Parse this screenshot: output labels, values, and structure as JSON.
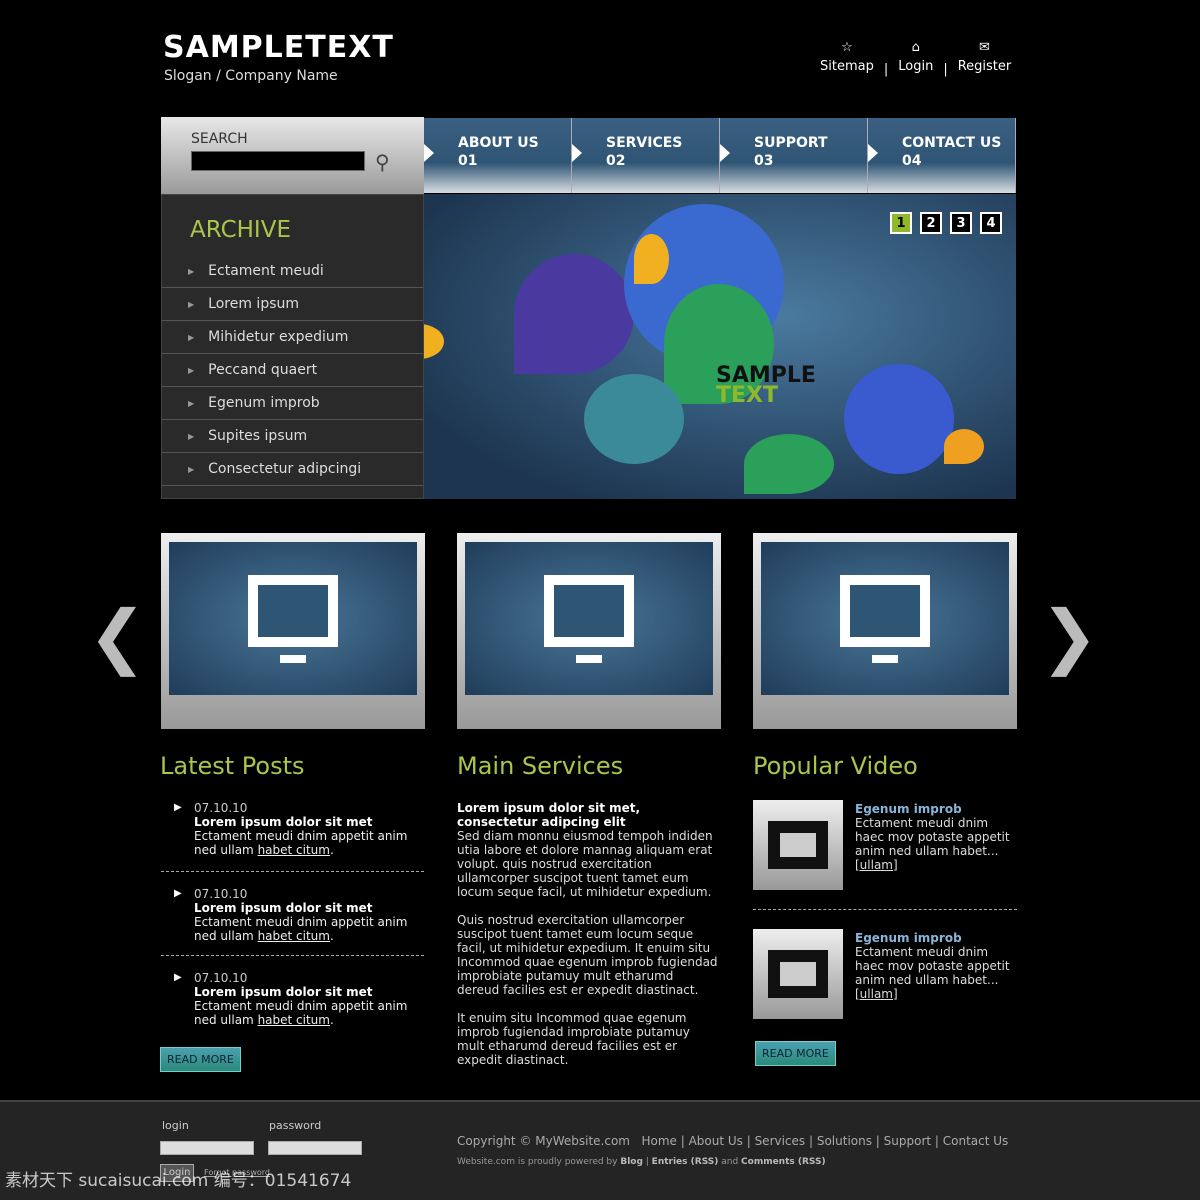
{
  "header": {
    "logo": "SAMPLETEXT",
    "slogan": "Slogan / Company Name",
    "links": [
      {
        "label": "Sitemap",
        "icon": "star-icon"
      },
      {
        "label": "Login",
        "icon": "home-icon"
      },
      {
        "label": "Register",
        "icon": "envelope-icon"
      }
    ],
    "separator": "|"
  },
  "search": {
    "label": "SEARCH",
    "value": ""
  },
  "nav": [
    {
      "label": "ABOUT US",
      "num": "01"
    },
    {
      "label": "SERVICES",
      "num": "02"
    },
    {
      "label": "SUPPORT",
      "num": "03"
    },
    {
      "label": "CONTACT US",
      "num": "04"
    }
  ],
  "archive": {
    "title": "ARCHIVE",
    "items": [
      "Ectament meudi",
      "Lorem ipsum",
      "Mihidetur expedium",
      "Peccand quaert",
      "Egenum improb",
      "Supites ipsum",
      "Consectetur adipcingi"
    ]
  },
  "banner": {
    "text_line1": "SAMPLE",
    "text_line2": "TEXT",
    "pages": [
      "1",
      "2",
      "3",
      "4"
    ],
    "active_page": 1
  },
  "latest": {
    "title": "Latest Posts",
    "posts": [
      {
        "date": "07.10.10",
        "title": "Lorem ipsum dolor sit met",
        "text": "Ectament meudi dnim appetit anim ned ullam ",
        "link": "habet citum",
        "end": "."
      },
      {
        "date": "07.10.10",
        "title": "Lorem ipsum dolor sit met",
        "text": "Ectament meudi dnim appetit anim ned ullam ",
        "link": "habet citum",
        "end": "."
      },
      {
        "date": "07.10.10",
        "title": "Lorem ipsum dolor sit met",
        "text": "Ectament meudi dnim appetit anim ned ullam ",
        "link": "habet citum",
        "end": "."
      }
    ],
    "read_more": "READ MORE"
  },
  "services": {
    "title": "Main Services",
    "heading": "Lorem ipsum dolor sit met, consectetur adipcing elit",
    "p1": "Sed diam monnu eiusmod tempoh indiden utia labore et dolore mannag aliquam erat volupt. quis nostrud exercitation ullamcorper suscipot tuent tamet eum locum seque facil, ut mihidetur expedium.",
    "p2": "Quis nostrud exercitation ullamcorper suscipot tuent tamet eum locum seque facil, ut mihidetur expedium. It enuim situ Incommod quae egenum improb fugiendad improbiate putamuy mult etharumd dereud facilies est er expedit diastinact.",
    "p3": "It enuim situ Incommod quae egenum improb fugiendad improbiate putamuy mult etharumd dereud facilies est er expedit diastinact."
  },
  "video": {
    "title": "Popular Video",
    "items": [
      {
        "title": "Egenum improb",
        "text": "Ectament meudi dnim haec mov potaste appetit anim ned ullam habet...",
        "link": "[ullam]"
      },
      {
        "title": "Egenum improb",
        "text": "Ectament meudi dnim haec mov potaste appetit anim ned ullam habet...",
        "link": "[ullam]"
      }
    ],
    "read_more": "READ MORE"
  },
  "footer": {
    "login_label": "login",
    "password_label": "password",
    "login_button": "Login",
    "forgot": "Forgot password",
    "copyright": "Copyright © MyWebsite.com",
    "links": [
      "Home",
      "About Us",
      "Services",
      "Solutions",
      "Support",
      "Contact Us"
    ],
    "powered_pre": "Website.com is proudly powered by ",
    "blog": "Blog",
    "entries": "Entries (RSS)",
    "and": " and ",
    "comments": "Comments (RSS)"
  },
  "watermark": "素材天下 sucaisucai.com  编号：01541674",
  "colors": {
    "accent_green": "#a9c64a",
    "nav_blue": "#2f5575",
    "background": "#000000"
  }
}
